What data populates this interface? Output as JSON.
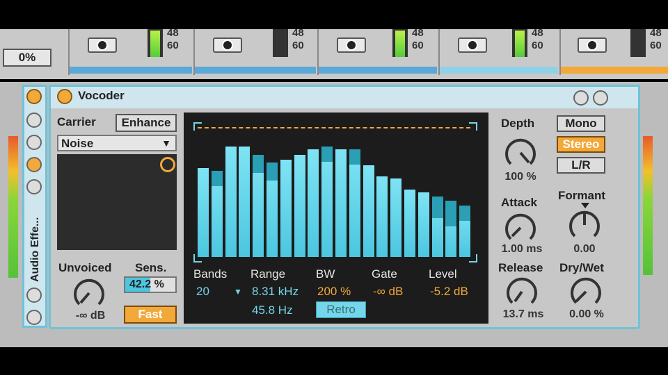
{
  "mixer": {
    "percent_value": "0%",
    "meter_labels": {
      "top": "48",
      "bottom": "60"
    }
  },
  "device": {
    "title": "Vocoder",
    "sidebar_label": "Audio Effe...",
    "carrier_label": "Carrier",
    "enhance_button": "Enhance",
    "carrier_select": "Noise",
    "unvoiced_label": "Unvoiced",
    "unvoiced_value": "-∞ dB",
    "sens_label": "Sens.",
    "sens_value": "42.2 %",
    "fast_button": "Fast",
    "bands_label": "Bands",
    "bands_value": "20",
    "range_label": "Range",
    "range_high": "8.31 kHz",
    "range_low": "45.8 Hz",
    "bw_label": "BW",
    "bw_value": "200 %",
    "retro_button": "Retro",
    "gate_label": "Gate",
    "gate_value": "-∞ dB",
    "level_label": "Level",
    "level_value": "-5.2 dB",
    "depth_label": "Depth",
    "depth_value": "100 %",
    "mono_button": "Mono",
    "stereo_button": "Stereo",
    "lr_button": "L/R",
    "attack_label": "Attack",
    "attack_value": "1.00 ms",
    "formant_label": "Formant",
    "formant_value": "0.00",
    "release_label": "Release",
    "release_value": "13.7 ms",
    "drywet_label": "Dry/Wet",
    "drywet_value": "0.00 %"
  },
  "spectrum_levels": [
    0.66,
    0.64,
    0.82,
    0.82,
    0.76,
    0.7,
    0.72,
    0.76,
    0.8,
    0.82,
    0.8,
    0.8,
    0.68,
    0.6,
    0.58,
    0.5,
    0.48,
    0.45,
    0.42,
    0.38
  ],
  "spectrum_caps": [
    0.66,
    0.6,
    0.82,
    0.82,
    0.7,
    0.64,
    0.72,
    0.76,
    0.8,
    0.78,
    0.8,
    0.76,
    0.68,
    0.6,
    0.58,
    0.5,
    0.48,
    0.36,
    0.3,
    0.34
  ],
  "colors": {
    "accent": "#f2a93a",
    "spectrum": "#4cc6e0",
    "device_border": "#6fc3d8"
  }
}
